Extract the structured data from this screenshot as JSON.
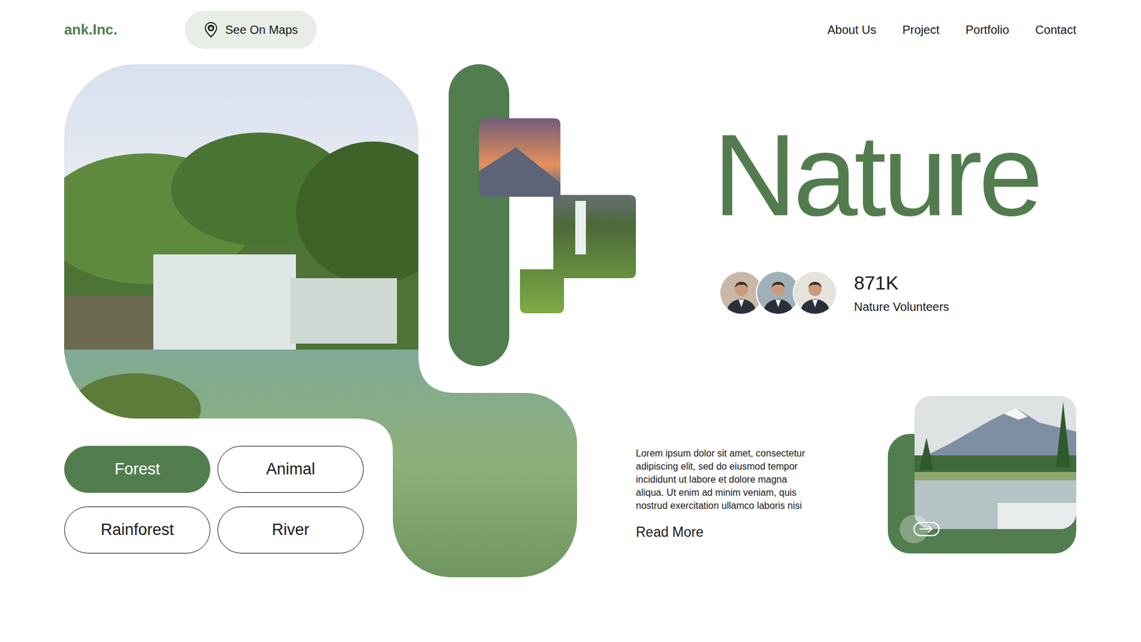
{
  "brand": {
    "logo": "ank.Inc."
  },
  "header": {
    "map_button": "See On Maps",
    "nav": [
      "About Us",
      "Project",
      "Portfolio",
      "Contact"
    ]
  },
  "hero": {
    "title": "Nature",
    "volunteers": {
      "count": "871K",
      "label": "Nature Volunteers"
    }
  },
  "categories": [
    {
      "label": "Forest",
      "selected": true
    },
    {
      "label": "Animal",
      "selected": false
    },
    {
      "label": "Rainforest",
      "selected": false
    },
    {
      "label": "River",
      "selected": false
    }
  ],
  "intro": {
    "text": "Lorem ipsum dolor sit amet, consectetur adipiscing elit, sed do eiusmod tempor incididunt ut labore et dolore magna aliqua. Ut enim ad minim veniam, quis nostrud exercitation ullamco laboris nisi",
    "link": "Read More"
  }
}
